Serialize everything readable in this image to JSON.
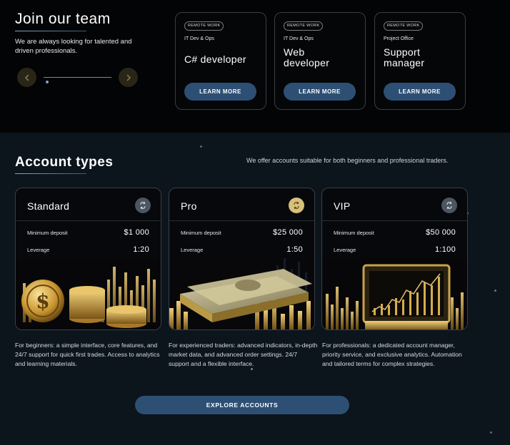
{
  "join": {
    "title": "Join our team",
    "description": "We are always looking for talented and driven professionals."
  },
  "jobs": [
    {
      "tag": "REMOTE WORK",
      "department": "IT Dev & Ops",
      "title": "C# developer",
      "button": "LEARN MORE"
    },
    {
      "tag": "REMOTE WORK",
      "department": "IT Dev & Ops",
      "title": "Web developer",
      "button": "LEARN MORE"
    },
    {
      "tag": "REMOTE WORK",
      "department": "Project Office",
      "title": "Support manager",
      "button": "LEARN MORE"
    }
  ],
  "accounts_section": {
    "title": "Account types",
    "intro": "We offer accounts suitable for both beginners and professional traders.",
    "min_deposit_label": "Minimum deposit",
    "leverage_label": "Leverage",
    "explore_button": "EXPLORE ACCOUNTS"
  },
  "accounts": [
    {
      "name": "Standard",
      "min_deposit": "$1 000",
      "leverage": "1:20",
      "icon": "swap-icon",
      "icon_color": "#4c5561",
      "description": "For beginners: a simple interface, core features, and 24/7 support for quick first trades. Access to analytics and learning materials."
    },
    {
      "name": "Pro",
      "min_deposit": "$25 000",
      "leverage": "1:50",
      "icon": "swap-icon",
      "icon_color": "#d9c07a",
      "description": "For experienced traders: advanced indicators, in-depth market data, and advanced order settings. 24/7 support and a flexible interface."
    },
    {
      "name": "VIP",
      "min_deposit": "$50 000",
      "leverage": "1:100",
      "icon": "swap-icon",
      "icon_color": "#4c5561",
      "description": "For professionals: a dedicated account manager, priority service, and exclusive analytics. Automation and tailored terms for complex strategies."
    }
  ],
  "colors": {
    "accent_button": "#2d4f74",
    "gold": "#d9c07a",
    "top_background": "#030405",
    "bottom_background": "#0c141c"
  }
}
